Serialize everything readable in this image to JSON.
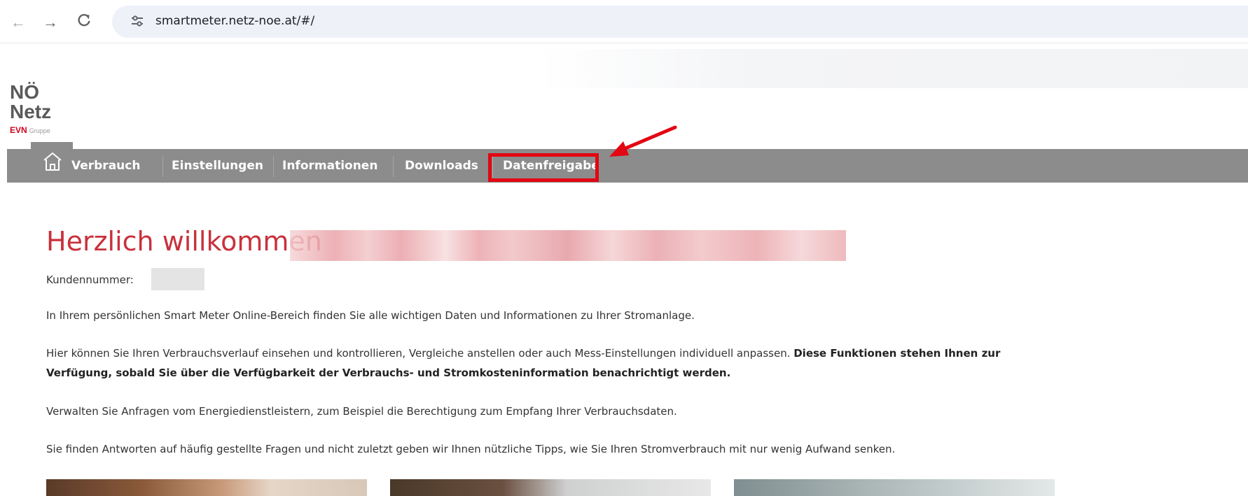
{
  "browser": {
    "url": "smartmeter.netz-noe.at/#/"
  },
  "logo": {
    "line1": "NÖ",
    "line2": "Netz",
    "brand": "EVN",
    "group": "Gruppe"
  },
  "nav": {
    "items": [
      {
        "label": "Verbrauch"
      },
      {
        "label": "Einstellungen"
      },
      {
        "label": "Informationen"
      },
      {
        "label": "Downloads"
      },
      {
        "label": "Datenfreigabe"
      }
    ]
  },
  "content": {
    "welcome": "Herzlich willkommen",
    "customer_label": "Kundennummer:",
    "p1": "In Ihrem persönlichen Smart Meter Online-Bereich finden Sie alle wichtigen Daten und Informationen zu Ihrer Stromanlage.",
    "p2_normal": "Hier können Sie Ihren Verbrauchsverlauf einsehen und kontrollieren, Vergleiche anstellen oder auch Mess-Einstellungen individuell anpassen. ",
    "p2_bold": "Diese Funktionen stehen Ihnen zur Verfügung, sobald Sie über die Verfügbarkeit der Verbrauchs- und Stromkosteninformation benachrichtigt werden.",
    "p3": "Verwalten Sie Anfragen vom Energiedienstleistern, zum Beispiel die Berechtigung zum Empfang Ihrer Verbrauchsdaten.",
    "p4": "Sie finden Antworten auf häufig gestellte Fragen und nicht zuletzt geben wir Ihnen nützliche Tipps, wie Sie Ihren Stromverbrauch mit nur wenig Aufwand senken."
  },
  "colors": {
    "nav_bg": "#8c8c8c",
    "accent_red": "#c8313b",
    "highlight": "#e30613"
  }
}
